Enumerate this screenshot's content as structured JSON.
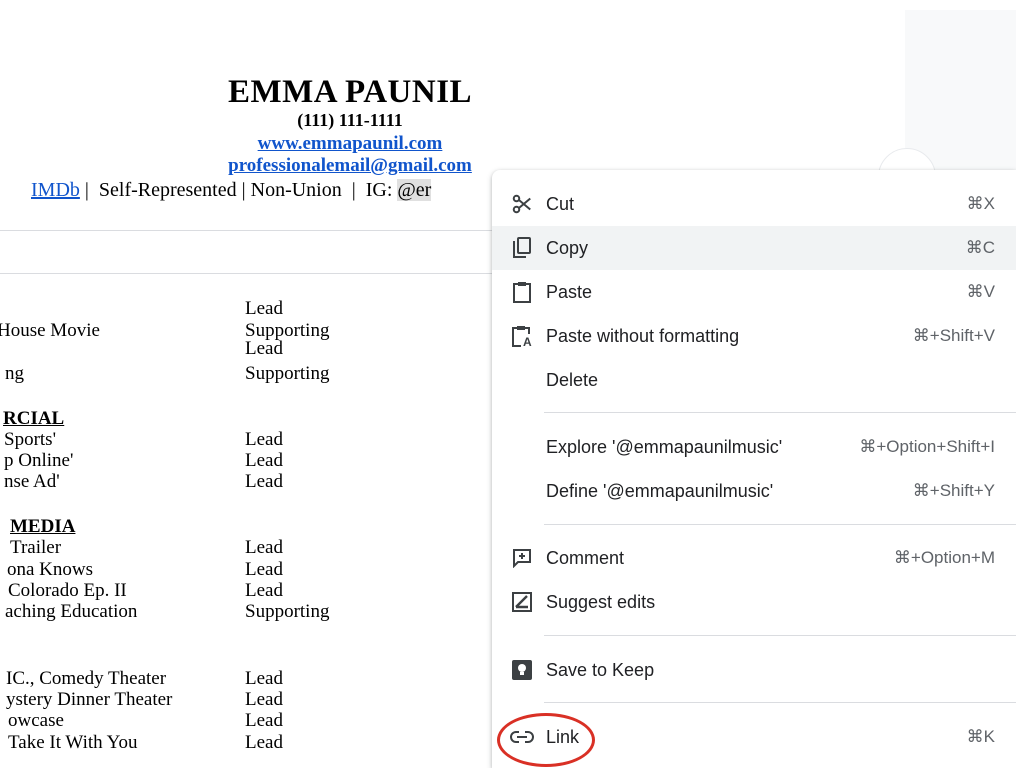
{
  "document": {
    "name": "EMMA PAUNIL",
    "phone": "(111) 111-1111",
    "website": "www.emmapaunil.com",
    "email": "professionalemail@gmail.com",
    "info_imdb": "IMDb",
    "info_rest": " |  Self-Represented | Non-Union  |  IG: ",
    "info_handle_visible": "@er",
    "credits": [
      {
        "title": "",
        "role": "Lead"
      },
      {
        "title": "House Movie",
        "role": "Supporting"
      },
      {
        "title": "",
        "role": "Lead"
      },
      {
        "title": "ng",
        "role": "Supporting"
      }
    ],
    "sections": {
      "commercial": "RCIAL",
      "new_media": "MEDIA"
    },
    "commercial_credits": [
      {
        "title": "Sports'",
        "role": "Lead"
      },
      {
        "title": "p Online'",
        "role": "Lead"
      },
      {
        "title": "nse Ad'",
        "role": "Lead"
      }
    ],
    "new_media_credits": [
      {
        "title": "Trailer",
        "role": "Lead"
      },
      {
        "title": "ona Knows",
        "role": "Lead"
      },
      {
        "title": "Colorado Ep. II",
        "role": "Lead"
      },
      {
        "title": "aching Education",
        "role": "Supporting"
      }
    ],
    "theater_credits": [
      {
        "title": "IC., Comedy Theater",
        "role": "Lead"
      },
      {
        "title": "ystery Dinner Theater",
        "role": "Lead"
      },
      {
        "title": "owcase",
        "role": "Lead"
      },
      {
        "title": "Take It With You",
        "role": "Lead"
      }
    ]
  },
  "context_menu": {
    "items": [
      {
        "icon": "scissors-icon",
        "label": "Cut",
        "shortcut": "⌘X"
      },
      {
        "icon": "copy-icon",
        "label": "Copy",
        "shortcut": "⌘C"
      },
      {
        "icon": "clipboard-icon",
        "label": "Paste",
        "shortcut": "⌘V"
      },
      {
        "icon": "clipboard-text-icon",
        "label": "Paste without formatting",
        "shortcut": "⌘+Shift+V"
      },
      {
        "icon": "",
        "label": "Delete",
        "shortcut": ""
      },
      {
        "icon": "",
        "label": "Explore '@emmapaunilmusic'",
        "shortcut": "⌘+Option+Shift+I"
      },
      {
        "icon": "",
        "label": "Define '@emmapaunilmusic'",
        "shortcut": "⌘+Shift+Y"
      },
      {
        "icon": "comment-add-icon",
        "label": "Comment",
        "shortcut": "⌘+Option+M"
      },
      {
        "icon": "suggest-edit-icon",
        "label": "Suggest edits",
        "shortcut": ""
      },
      {
        "icon": "keep-icon",
        "label": "Save to Keep",
        "shortcut": ""
      },
      {
        "icon": "link-icon",
        "label": "Link",
        "shortcut": "⌘K"
      }
    ],
    "hovered": "Copy"
  },
  "colors": {
    "link": "#1155cc",
    "menu_hover": "#f1f3f4",
    "annotation": "#d93025"
  }
}
